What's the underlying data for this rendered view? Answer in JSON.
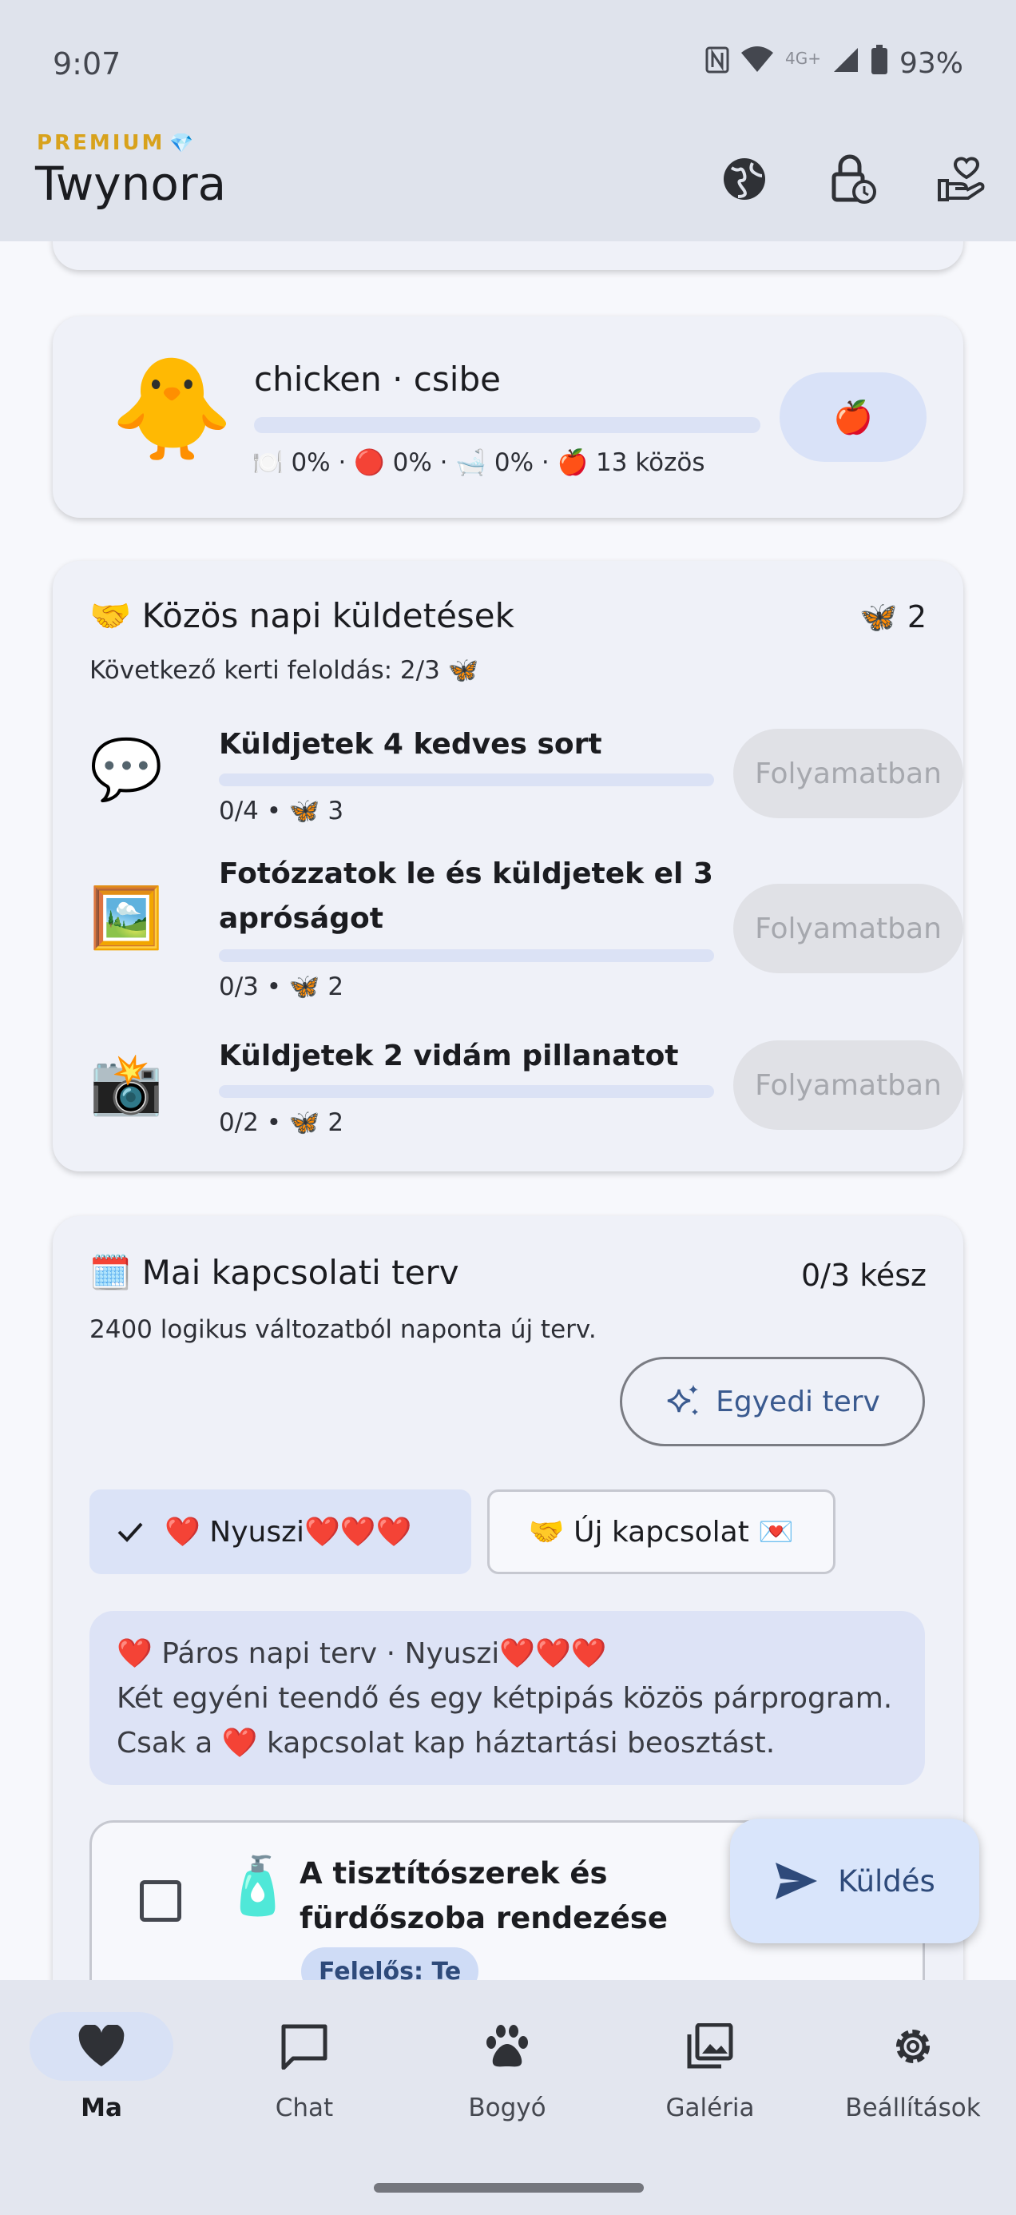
{
  "status_bar": {
    "time": "9:07",
    "network": "4G+",
    "battery": "93%"
  },
  "app_bar": {
    "premium_label": "PREMIUM",
    "premium_icon": "💎",
    "title": "Twynora",
    "actions": [
      "globe-icon",
      "lock-clock-icon",
      "heart-hand-icon"
    ]
  },
  "pet": {
    "emoji": "🐥",
    "name": "chicken · csibe",
    "stats": "🍽️ 0% · 🔴 0% · 🛁 0% · 🍎 13 közös",
    "feed_button": "🍎"
  },
  "missions": {
    "title": "🤝 Közös napi küldetések",
    "butterflies": "🦋 2",
    "subtitle": "Következő kerti feloldás: 2/3 🦋",
    "items": [
      {
        "icon": "💬",
        "title": "Küldjetek 4 kedves sort",
        "meta": "0/4 • 🦋 3",
        "progress": 0,
        "status": "Folyamatban"
      },
      {
        "icon": "🖼️",
        "title": "Fotózzatok le és küldjetek el 3 apróságot",
        "meta": "0/3 • 🦋 2",
        "progress": 0,
        "status": "Folyamatban"
      },
      {
        "icon": "📸",
        "title": "Küldjetek 2 vidám pillanatot",
        "meta": "0/2 • 🦋 2",
        "progress": 0,
        "status": "Folyamatban"
      }
    ]
  },
  "plan": {
    "title": "🗓️ Mai kapcsolati terv",
    "done": "0/3 kész",
    "subtitle": "2400 logikus változatból naponta új terv.",
    "custom_button": "Egyedi terv",
    "chips": {
      "selected": "❤️ Nyuszi❤️❤️❤️",
      "other": "🤝 Új kapcsolat 💌"
    },
    "info_lines": [
      "❤️ Páros napi terv · Nyuszi❤️❤️❤️",
      "Két egyéni teendő és egy kétpipás közös párprogram.",
      "Csak a ❤️ kapcsolat kap háztartási beosztást."
    ],
    "task": {
      "icon": "🧴",
      "title": "A tisztítószerek és fürdőszoba rendezése",
      "assignee": "Felelős: Te"
    }
  },
  "fab": {
    "label": "Küldés"
  },
  "bottom_nav": [
    {
      "label": "Ma",
      "icon": "heart-icon",
      "active": true
    },
    {
      "label": "Chat",
      "icon": "chat-icon",
      "active": false
    },
    {
      "label": "Bogyó",
      "icon": "paw-icon",
      "active": false
    },
    {
      "label": "Galéria",
      "icon": "gallery-icon",
      "active": false
    },
    {
      "label": "Beállítások",
      "icon": "gear-icon",
      "active": false
    }
  ]
}
